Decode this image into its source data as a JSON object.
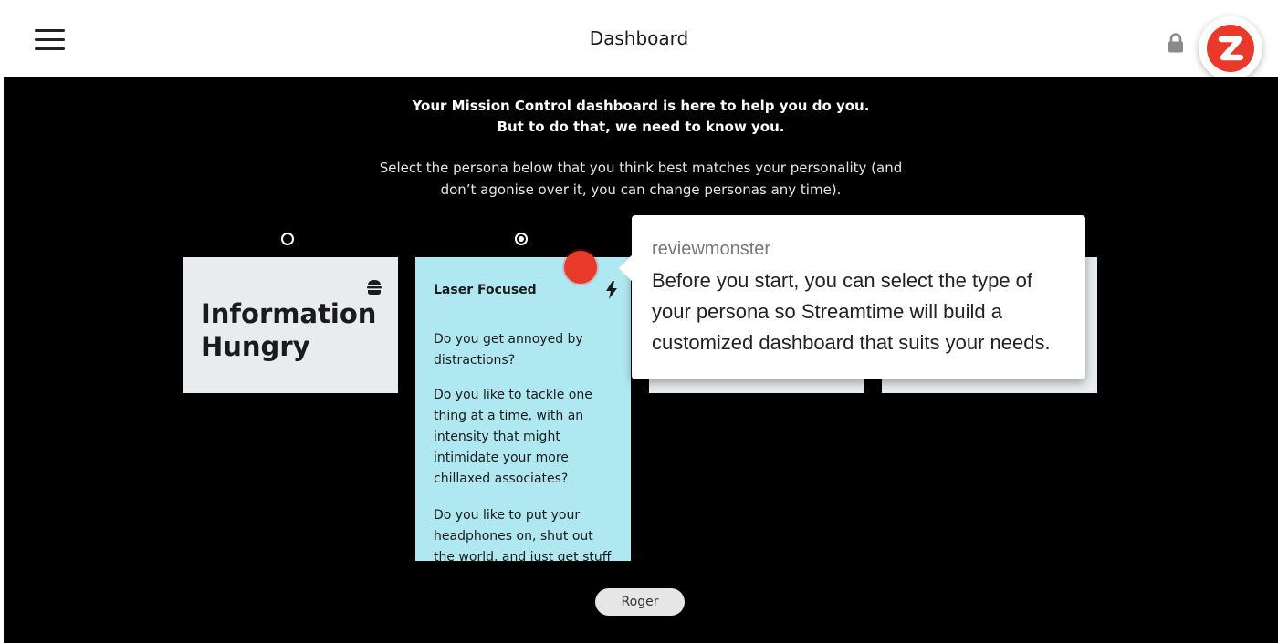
{
  "header": {
    "title": "Dashboard",
    "menu_icon": "hamburger-menu-icon",
    "lock_icon": "lock-icon",
    "badge_icon": "z-logo-icon"
  },
  "intro": {
    "line1": "Your Mission Control dashboard is here to help you do you.",
    "line2": "But to do that, we need to know you."
  },
  "instructions": {
    "line1": "Select the persona below that you think best matches your personality (and",
    "line2": "don’t agonise over it, you can change personas any time)."
  },
  "personas": [
    {
      "title": "Information Hungry",
      "icon": "burger-icon",
      "selected": false
    },
    {
      "title": "Laser Focused",
      "icon": "lightning-bolt-icon",
      "selected": true,
      "questions": [
        "Do you get annoyed by distractions?",
        "Do you like to tackle one thing at a time, with an intensity that might intimidate your more chillaxed associates?",
        "Do you like to put your headphones on, shut out the world, and just get stuff"
      ]
    }
  ],
  "tooltip": {
    "author": "reviewmonster",
    "body": "Before you start, you can select the type of your persona so Streamtime will build a customized dashboard that suits your needs."
  },
  "footer": {
    "user_name": "Roger"
  },
  "colors": {
    "accent_red": "#e8392a",
    "card_blue": "#b0e8f1",
    "card_grey": "#e8ecee",
    "background": "#000000"
  }
}
